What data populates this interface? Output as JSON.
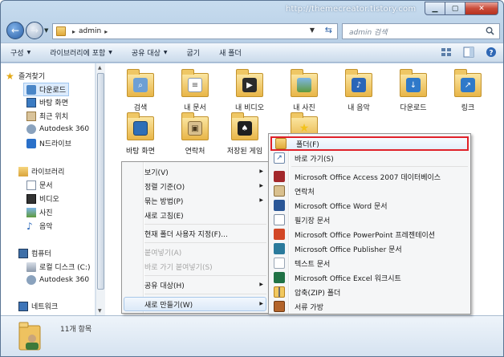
{
  "watermark": "http://themecreator.tistory.com",
  "address": {
    "path": "admin",
    "search_placeholder": "admin 검색"
  },
  "toolbar": {
    "organize": "구성",
    "include_library": "라이브러리에 포함",
    "share_with": "공유 대상",
    "burn": "굽기",
    "new_folder": "새 폴더"
  },
  "navpane": {
    "favorites": "즐겨찾기",
    "downloads": "다운로드",
    "desktop": "바탕 화면",
    "recent": "최근 위치",
    "autodesk360": "Autodesk 360",
    "ndrive": "N드라이브",
    "libraries": "라이브러리",
    "documents": "문서",
    "videos": "비디오",
    "pictures": "사진",
    "music": "음악",
    "computer": "컴퓨터",
    "local_disk": "로컬 디스크 (C:)",
    "autodesk360_2": "Autodesk 360",
    "network": "네트워크"
  },
  "files": [
    {
      "label": "검색",
      "icon": "search-folder-icon"
    },
    {
      "label": "내 문서",
      "icon": "documents-folder-icon"
    },
    {
      "label": "내 비디오",
      "icon": "videos-folder-icon"
    },
    {
      "label": "내 사진",
      "icon": "pictures-folder-icon"
    },
    {
      "label": "내 음악",
      "icon": "music-folder-icon"
    },
    {
      "label": "다운로드",
      "icon": "downloads-folder-icon"
    },
    {
      "label": "링크",
      "icon": "links-folder-icon"
    },
    {
      "label": "바탕 화면",
      "icon": "desktop-folder-icon"
    },
    {
      "label": "연락처",
      "icon": "contacts-folder-icon"
    },
    {
      "label": "저장된 게임",
      "icon": "saved-games-folder-icon"
    },
    {
      "label": "",
      "icon": "favorites-folder-icon"
    }
  ],
  "context_menu": {
    "view": "보기(V)",
    "sort_by": "정렬 기준(O)",
    "group_by": "묶는 방법(P)",
    "refresh": "새로 고침(E)",
    "customize": "현재 폴더 사용자 지정(F)...",
    "paste": "붙여넣기(A)",
    "paste_shortcut": "바로 가기 붙여넣기(S)",
    "share_with": "공유 대상(H)",
    "new": "새로 만들기(W)"
  },
  "submenu": {
    "folder": "폴더(F)",
    "shortcut": "바로 가기(S)",
    "access": "Microsoft Office Access 2007 데이터베이스",
    "contact": "연락처",
    "word": "Microsoft Office Word 문서",
    "journal": "필기장 문서",
    "powerpoint": "Microsoft Office PowerPoint 프레젠테이션",
    "publisher": "Microsoft Office Publisher 문서",
    "text": "텍스트 문서",
    "excel": "Microsoft Office Excel 워크시트",
    "zip": "압축(ZIP) 폴더",
    "briefcase": "서류 가방"
  },
  "status": {
    "item_count": "11개 항목"
  },
  "colors": {
    "highlight_border": "#e0212a",
    "selection": "#dcebfc",
    "window_frame": "#b6cde4"
  }
}
